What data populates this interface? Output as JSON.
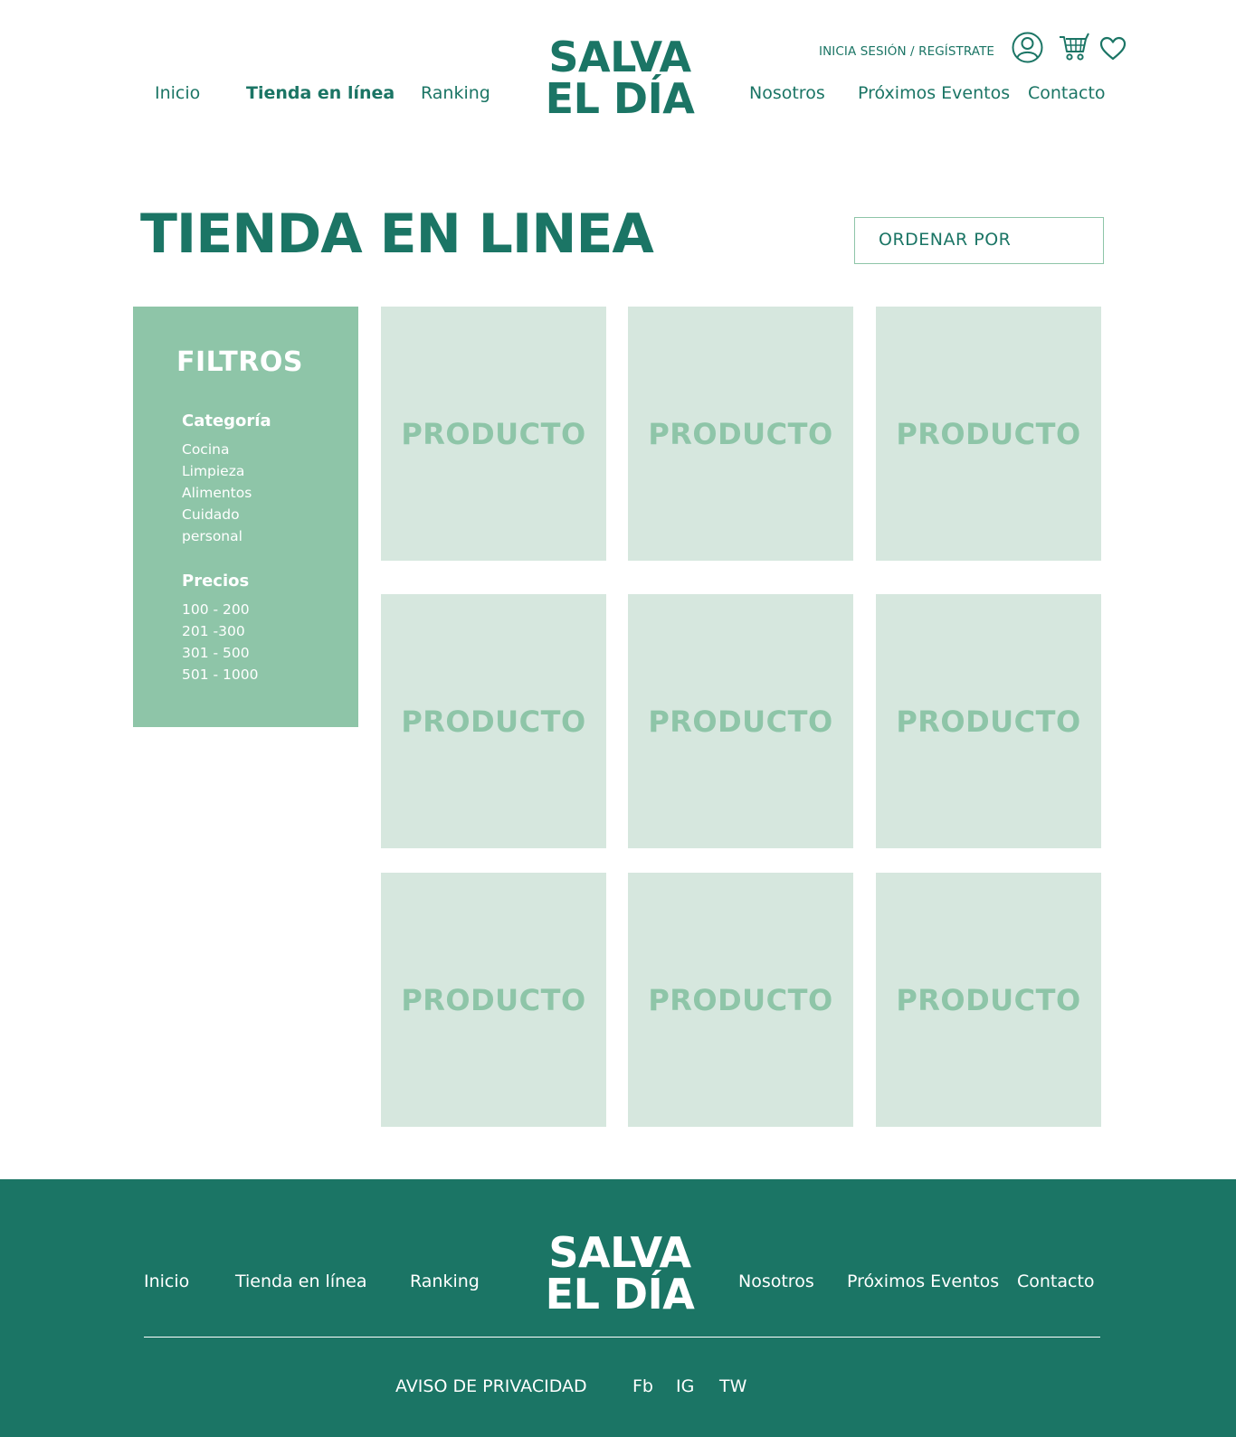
{
  "header": {
    "logo_line1": "SALVA",
    "logo_line2": "EL DÍA",
    "auth_link": "INICIA SESIÓN / REGÍSTRATE",
    "nav_left": [
      "Inicio",
      "Tienda en línea",
      "Ranking"
    ],
    "nav_right": [
      "Nosotros",
      "Próximos Eventos",
      "Contacto"
    ],
    "active_nav": "Tienda en línea",
    "icons": [
      "user-icon",
      "cart-icon",
      "heart-icon"
    ]
  },
  "main": {
    "title": "TIENDA EN LINEA",
    "sort_label": "ORDENAR POR",
    "filters": {
      "title": "FILTROS",
      "category_heading": "Categoría",
      "categories": [
        "Cocina",
        "Limpieza",
        "Alimentos",
        "Cuidado",
        "personal"
      ],
      "price_heading": "Precios",
      "prices": [
        "100 - 200",
        "201 -300",
        "301 - 500",
        "501 - 1000"
      ]
    },
    "products": [
      "PRODUCTO",
      "PRODUCTO",
      "PRODUCTO",
      "PRODUCTO",
      "PRODUCTO",
      "PRODUCTO",
      "PRODUCTO",
      "PRODUCTO",
      "PRODUCTO"
    ]
  },
  "footer": {
    "logo_line1": "SALVA",
    "logo_line2": "EL DÍA",
    "nav_left": [
      "Inicio",
      "Tienda en línea",
      "Ranking"
    ],
    "nav_right": [
      "Nosotros",
      "Próximos Eventos",
      "Contacto"
    ],
    "privacy": "AVISO DE PRIVACIDAD",
    "social": [
      "Fb",
      "IG",
      "TW"
    ]
  },
  "colors": {
    "primary": "#1b7565",
    "filter_bg": "#8ec5a8",
    "product_bg": "#d6e7de",
    "product_text": "#8ec5a8"
  }
}
